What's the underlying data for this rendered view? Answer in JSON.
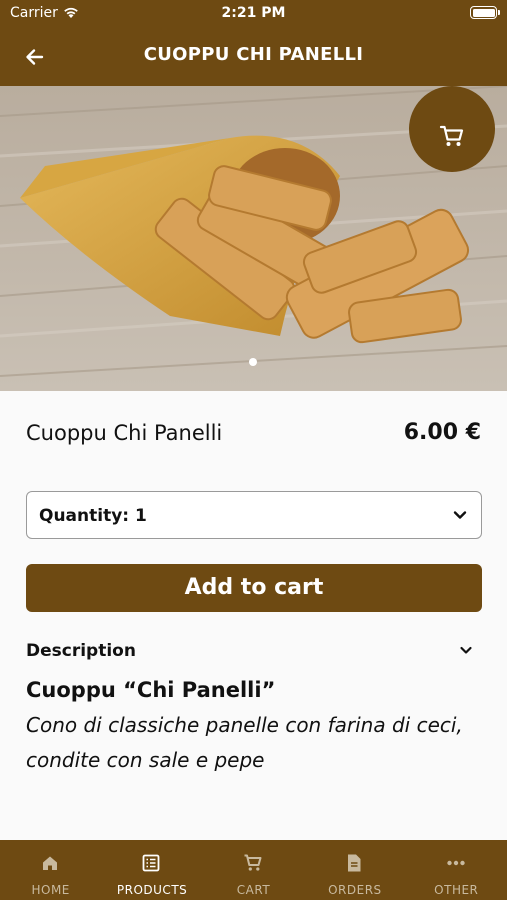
{
  "status_bar": {
    "carrier": "Carrier",
    "time": "2:21 PM"
  },
  "header": {
    "title": "CUOPPU CHI PANELLI"
  },
  "product": {
    "name": "Cuoppu Chi Panelli",
    "price": "6.00 €",
    "quantity_label": "Quantity: 1",
    "quantity_value": 1,
    "add_to_cart_label": "Add to cart",
    "image_slide_count": 1,
    "description_label": "Description",
    "description_title": "Cuoppu “Chi Panelli”",
    "description_text": "Cono di classiche panelle con farina di ceci, condite con sale e pepe"
  },
  "tabs": [
    {
      "label": "HOME",
      "icon": "home-icon",
      "active": false
    },
    {
      "label": "PRODUCTS",
      "icon": "list-icon",
      "active": true
    },
    {
      "label": "CART",
      "icon": "cart-icon",
      "active": false
    },
    {
      "label": "ORDERS",
      "icon": "document-icon",
      "active": false
    },
    {
      "label": "OTHER",
      "icon": "more-icon",
      "active": false
    }
  ],
  "colors": {
    "brand": "#6e4a12",
    "background": "#fafafa",
    "tab_inactive": "#c8b99e"
  }
}
